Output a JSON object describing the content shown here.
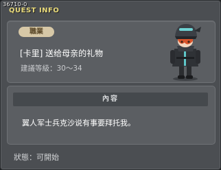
{
  "header": {
    "quest_id": "36710-0",
    "title": "QUEST INFO"
  },
  "quest": {
    "job_label": "職業",
    "name": "[卡里] 送给母亲的礼物",
    "level_text": "建議等級：30～34",
    "character_icon": "helmeted-soldier-avatar"
  },
  "content": {
    "heading": "內容",
    "text": "翼人军士兵克沙说有事要拜托我。"
  },
  "footer": {
    "status_text": "狀態：可開始"
  },
  "colors": {
    "window_bg": "#4b4e52",
    "panel_bg": "#5b5e62",
    "title_yellow": "#e7d97a",
    "tag_bg": "#d7c8a7"
  }
}
